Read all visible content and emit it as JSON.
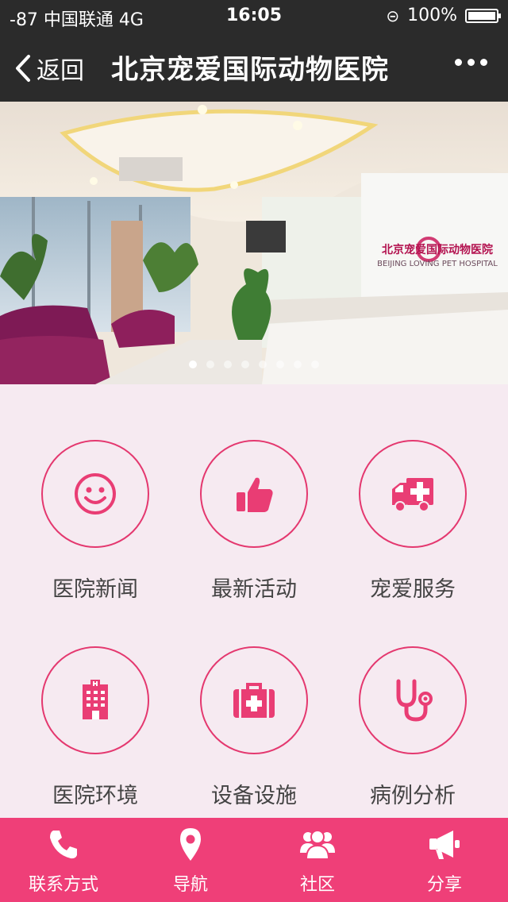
{
  "status_bar": {
    "signal": "-87 中国联通  4G",
    "time": "16:05",
    "battery": "100%"
  },
  "nav": {
    "back_label": "返回",
    "title": "北京宠爱国际动物医院"
  },
  "banner": {
    "sign_cn": "北京宠爱国际动物医院",
    "sign_en": "BEIJING LOVING PET HOSPITAL",
    "dot_count": 8,
    "active_dot": 0
  },
  "menu": [
    {
      "label": "医院新闻",
      "icon": "smile-icon"
    },
    {
      "label": "最新活动",
      "icon": "thumbs-up-icon"
    },
    {
      "label": "宠爱服务",
      "icon": "ambulance-icon"
    },
    {
      "label": "医院环境",
      "icon": "building-icon"
    },
    {
      "label": "设备设施",
      "icon": "medkit-icon"
    },
    {
      "label": "病例分析",
      "icon": "stethoscope-icon"
    }
  ],
  "tabs": [
    {
      "label": "联系方式",
      "icon": "phone-icon"
    },
    {
      "label": "导航",
      "icon": "map-pin-icon"
    },
    {
      "label": "社区",
      "icon": "users-icon"
    },
    {
      "label": "分享",
      "icon": "megaphone-icon"
    }
  ],
  "colors": {
    "accent": "#ef3f78",
    "icon": "#e93d74",
    "background": "#f6eaf1",
    "navbar": "#2b2b2b"
  }
}
